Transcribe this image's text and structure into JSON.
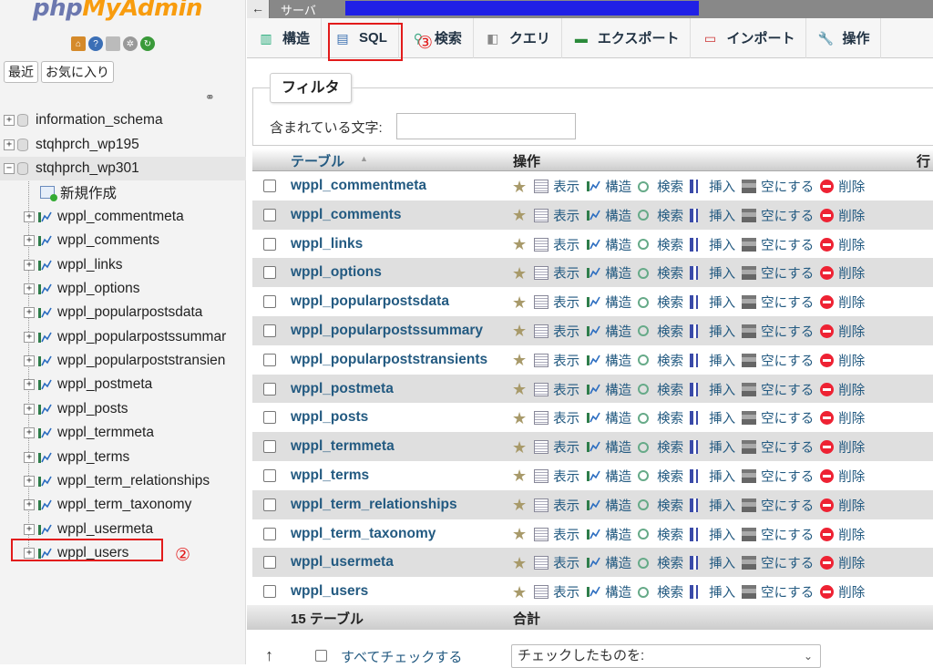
{
  "nav": {
    "logo_php": "php",
    "logo_my": "MyAdmin",
    "logo_icons": [
      "home-icon",
      "help-icon",
      "docs-icon",
      "settings-icon",
      "reload-icon"
    ],
    "recent_label": "最近",
    "favorites_label": "お気に入り",
    "tree": [
      {
        "type": "db",
        "label": "information_schema",
        "expander": "+"
      },
      {
        "type": "db",
        "label": "stqhprch_wp195",
        "expander": "+"
      },
      {
        "type": "db",
        "label": "stqhprch_wp301",
        "expander": "−",
        "active": true
      },
      {
        "type": "new",
        "label": "新規作成"
      },
      {
        "type": "tb",
        "label": "wppl_commentmeta"
      },
      {
        "type": "tb",
        "label": "wppl_comments"
      },
      {
        "type": "tb",
        "label": "wppl_links"
      },
      {
        "type": "tb",
        "label": "wppl_options"
      },
      {
        "type": "tb",
        "label": "wppl_popularpostsdata"
      },
      {
        "type": "tb",
        "label": "wppl_popularpostssummar"
      },
      {
        "type": "tb",
        "label": "wppl_popularpoststransien"
      },
      {
        "type": "tb",
        "label": "wppl_postmeta"
      },
      {
        "type": "tb",
        "label": "wppl_posts"
      },
      {
        "type": "tb",
        "label": "wppl_termmeta"
      },
      {
        "type": "tb",
        "label": "wppl_terms"
      },
      {
        "type": "tb",
        "label": "wppl_term_relationships"
      },
      {
        "type": "tb",
        "label": "wppl_term_taxonomy"
      },
      {
        "type": "tb",
        "label": "wppl_usermeta"
      },
      {
        "type": "tb",
        "label": "wppl_users"
      }
    ],
    "annotation_2": "②"
  },
  "main": {
    "back_arrow": "←",
    "server_label": "サーバ",
    "tabs": [
      {
        "label": "構造",
        "icon": "structure-icon"
      },
      {
        "label": "SQL",
        "icon": "sql-icon"
      },
      {
        "label": "検索",
        "icon": "search-icon"
      },
      {
        "label": "クエリ",
        "icon": "query-icon"
      },
      {
        "label": "エクスポート",
        "icon": "export-icon"
      },
      {
        "label": "インポート",
        "icon": "import-icon"
      },
      {
        "label": "操作",
        "icon": "wrench-icon"
      }
    ],
    "annotation_3": "③",
    "filter": {
      "legend": "フィルタ",
      "label": "含まれている文字:",
      "value": ""
    },
    "table": {
      "headers": {
        "table": "テーブル",
        "sort": "▲",
        "ops": "操作",
        "rows": "行"
      },
      "actions": [
        "表示",
        "構造",
        "検索",
        "挿入",
        "空にする",
        "削除"
      ],
      "rows": [
        "wppl_commentmeta",
        "wppl_comments",
        "wppl_links",
        "wppl_options",
        "wppl_popularpostsdata",
        "wppl_popularpostssummary",
        "wppl_popularpoststransients",
        "wppl_postmeta",
        "wppl_posts",
        "wppl_termmeta",
        "wppl_terms",
        "wppl_term_relationships",
        "wppl_term_taxonomy",
        "wppl_usermeta",
        "wppl_users"
      ],
      "footer_count": "15 テーブル",
      "footer_total": "合計"
    },
    "bottom": {
      "check_all": "すべてチェックする",
      "with_selected": "チェックしたものを:",
      "chevron": "⌄"
    }
  }
}
